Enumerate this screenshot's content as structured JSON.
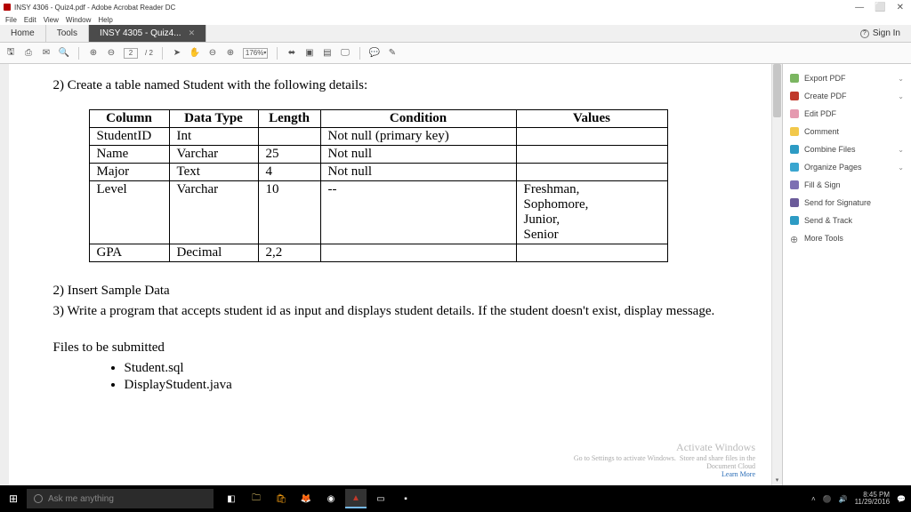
{
  "window": {
    "title": "INSY 4306 - Quiz4.pdf - Adobe Acrobat Reader DC",
    "controls": {
      "min": "—",
      "max": "⬜",
      "close": "✕"
    }
  },
  "menubar": [
    "File",
    "Edit",
    "View",
    "Window",
    "Help"
  ],
  "tabs": {
    "home": "Home",
    "tools": "Tools",
    "active": "INSY 4305 - Quiz4...",
    "signin": "Sign In"
  },
  "toolbar": {
    "page_current": "2",
    "page_sep": "/ 2",
    "zoom": "176%"
  },
  "document": {
    "q2_title": "2) Create a table named Student with the following details:",
    "table": {
      "headers": [
        "Column",
        "Data Type",
        "Length",
        "Condition",
        "Values"
      ],
      "rows": [
        [
          "StudentID",
          "Int",
          "",
          "Not null (primary key)",
          ""
        ],
        [
          "Name",
          "Varchar",
          "25",
          "Not null",
          ""
        ],
        [
          "Major",
          "Text",
          "4",
          "Not null",
          ""
        ],
        [
          "Level",
          "Varchar",
          "10",
          "--",
          "Freshman, Sophomore, Junior, Senior"
        ],
        [
          "GPA",
          "Decimal",
          "2,2",
          "",
          ""
        ]
      ]
    },
    "q2b": "2) Insert Sample Data",
    "q3": "3) Write a program that accepts student id as input and displays student details. If the student doesn't exist, display message.",
    "files_heading": "Files to be submitted",
    "files": [
      "Student.sql",
      "DisplayStudent.java"
    ]
  },
  "tools_pane": {
    "items": [
      {
        "label": "Export PDF",
        "color": "#7bb661",
        "chev": true
      },
      {
        "label": "Create PDF",
        "color": "#c0392b",
        "chev": true
      },
      {
        "label": "Edit PDF",
        "color": "#e59ab0",
        "chev": false
      },
      {
        "label": "Comment",
        "color": "#f2c84b",
        "chev": false
      },
      {
        "label": "Combine Files",
        "color": "#2d9bc4",
        "chev": true
      },
      {
        "label": "Organize Pages",
        "color": "#3aa6d0",
        "chev": true
      },
      {
        "label": "Fill & Sign",
        "color": "#7d6fb3",
        "chev": false
      },
      {
        "label": "Send for Signature",
        "color": "#6b5b9a",
        "chev": false
      },
      {
        "label": "Send & Track",
        "color": "#2d9bc4",
        "chev": false
      },
      {
        "label": "More Tools",
        "color": "#777",
        "chev": false,
        "plus": true
      }
    ]
  },
  "watermark": {
    "line1": "Activate Windows",
    "line2": "Go to Settings to activate Windows.",
    "cloud1": "Store and share files in the",
    "cloud2": "Document Cloud",
    "learn": "Learn More"
  },
  "taskbar": {
    "search_placeholder": "Ask me anything",
    "time": "8:45 PM",
    "date": "11/29/2016"
  }
}
